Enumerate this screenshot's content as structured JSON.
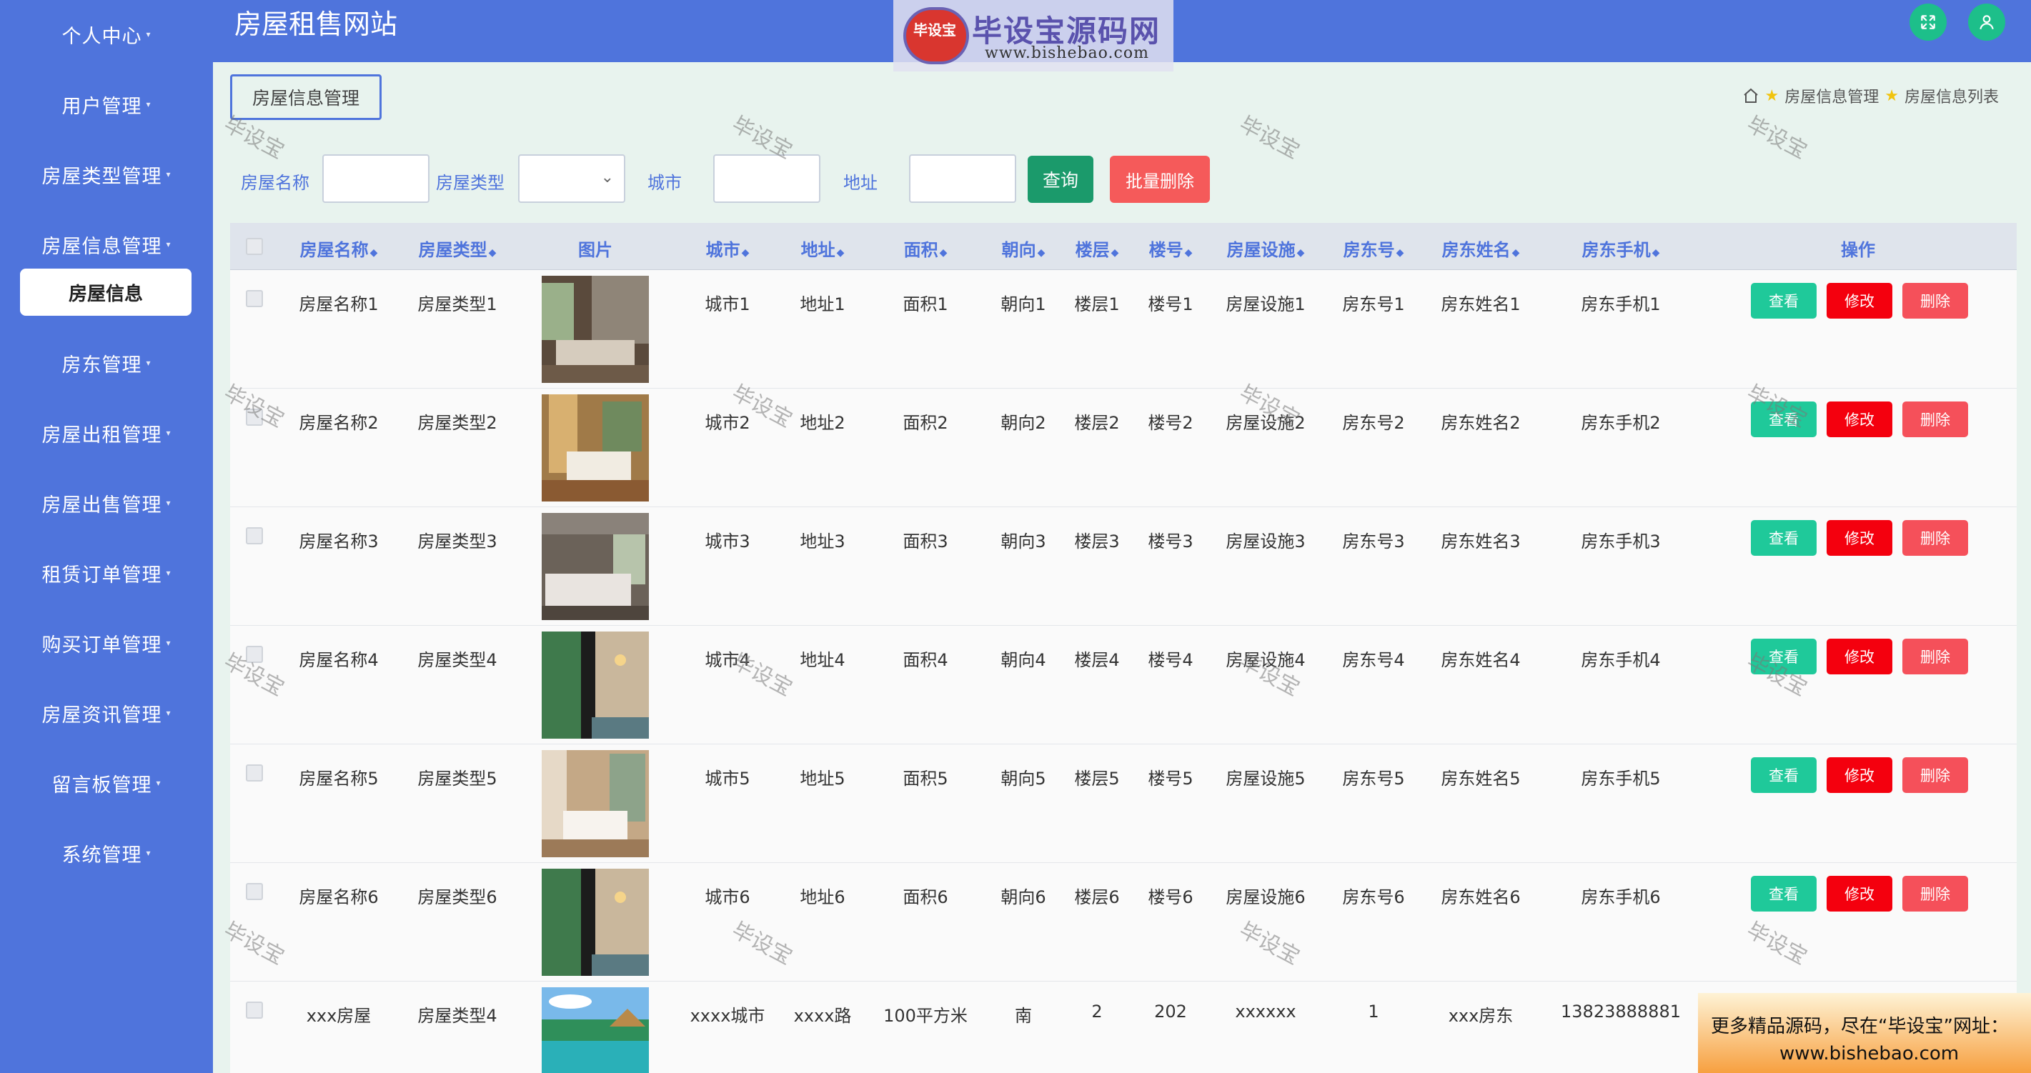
{
  "header": {
    "site_title": "房屋租售网站",
    "logo_badge": "毕设宝",
    "logo_name": "毕设宝源码网",
    "logo_url": "www.bishebao.com",
    "fullscreen_icon": "expand-icon",
    "user_icon": "user-icon"
  },
  "sidebar": {
    "items": [
      {
        "label": "个人中心"
      },
      {
        "label": "用户管理"
      },
      {
        "label": "房屋类型管理"
      },
      {
        "label": "房屋信息管理"
      },
      {
        "label": "房东管理"
      },
      {
        "label": "房屋出租管理"
      },
      {
        "label": "房屋出售管理"
      },
      {
        "label": "租赁订单管理"
      },
      {
        "label": "购买订单管理"
      },
      {
        "label": "房屋资讯管理"
      },
      {
        "label": "留言板管理"
      },
      {
        "label": "系统管理"
      }
    ],
    "active_sub": "房屋信息"
  },
  "tag": "房屋信息管理",
  "breadcrumb": {
    "level1": "房屋信息管理",
    "level2": "房屋信息列表"
  },
  "filters": {
    "name_label": "房屋名称",
    "type_label": "房屋类型",
    "city_label": "城市",
    "address_label": "地址",
    "query_button": "查询",
    "batch_delete_button": "批量删除"
  },
  "table": {
    "headers": [
      "房屋名称",
      "房屋类型",
      "图片",
      "城市",
      "地址",
      "面积",
      "朝向",
      "楼层",
      "楼号",
      "房屋设施",
      "房东号",
      "房东姓名",
      "房东手机",
      "操作"
    ],
    "rows": [
      {
        "name": "房屋名称1",
        "type": "房屋类型1",
        "city": "城市1",
        "address": "地址1",
        "area": "面积1",
        "orientation": "朝向1",
        "floor": "楼层1",
        "building": "楼号1",
        "facilities": "房屋设施1",
        "landlord_no": "房东号1",
        "landlord_name": "房东姓名1",
        "landlord_phone": "房东手机1"
      },
      {
        "name": "房屋名称2",
        "type": "房屋类型2",
        "city": "城市2",
        "address": "地址2",
        "area": "面积2",
        "orientation": "朝向2",
        "floor": "楼层2",
        "building": "楼号2",
        "facilities": "房屋设施2",
        "landlord_no": "房东号2",
        "landlord_name": "房东姓名2",
        "landlord_phone": "房东手机2"
      },
      {
        "name": "房屋名称3",
        "type": "房屋类型3",
        "city": "城市3",
        "address": "地址3",
        "area": "面积3",
        "orientation": "朝向3",
        "floor": "楼层3",
        "building": "楼号3",
        "facilities": "房屋设施3",
        "landlord_no": "房东号3",
        "landlord_name": "房东姓名3",
        "landlord_phone": "房东手机3"
      },
      {
        "name": "房屋名称4",
        "type": "房屋类型4",
        "city": "城市4",
        "address": "地址4",
        "area": "面积4",
        "orientation": "朝向4",
        "floor": "楼层4",
        "building": "楼号4",
        "facilities": "房屋设施4",
        "landlord_no": "房东号4",
        "landlord_name": "房东姓名4",
        "landlord_phone": "房东手机4"
      },
      {
        "name": "房屋名称5",
        "type": "房屋类型5",
        "city": "城市5",
        "address": "地址5",
        "area": "面积5",
        "orientation": "朝向5",
        "floor": "楼层5",
        "building": "楼号5",
        "facilities": "房屋设施5",
        "landlord_no": "房东号5",
        "landlord_name": "房东姓名5",
        "landlord_phone": "房东手机5"
      },
      {
        "name": "房屋名称6",
        "type": "房屋类型6",
        "city": "城市6",
        "address": "地址6",
        "area": "面积6",
        "orientation": "朝向6",
        "floor": "楼层6",
        "building": "楼号6",
        "facilities": "房屋设施6",
        "landlord_no": "房东号6",
        "landlord_name": "房东姓名6",
        "landlord_phone": "房东手机6"
      },
      {
        "name": "xxx房屋",
        "type": "房屋类型4",
        "city": "xxxx城市",
        "address": "xxxx路",
        "area": "100平方米",
        "orientation": "南",
        "floor": "2",
        "building": "202",
        "facilities": "xxxxxx",
        "landlord_no": "1",
        "landlord_name": "xxx房东",
        "landlord_phone": "13823888881"
      }
    ],
    "actions": {
      "view": "查看",
      "edit": "修改",
      "delete": "删除"
    }
  },
  "watermark": "毕设宝",
  "ad": {
    "line1": "更多精品源码，尽在“毕设宝”网址：",
    "line2": "www.bishebao.com"
  },
  "colors": {
    "primary": "#4f74dc",
    "background": "#e8f3ee",
    "query": "#1b9a6b",
    "danger": "#f55a5a",
    "view": "#1fc99a",
    "edit": "#f4000e"
  }
}
